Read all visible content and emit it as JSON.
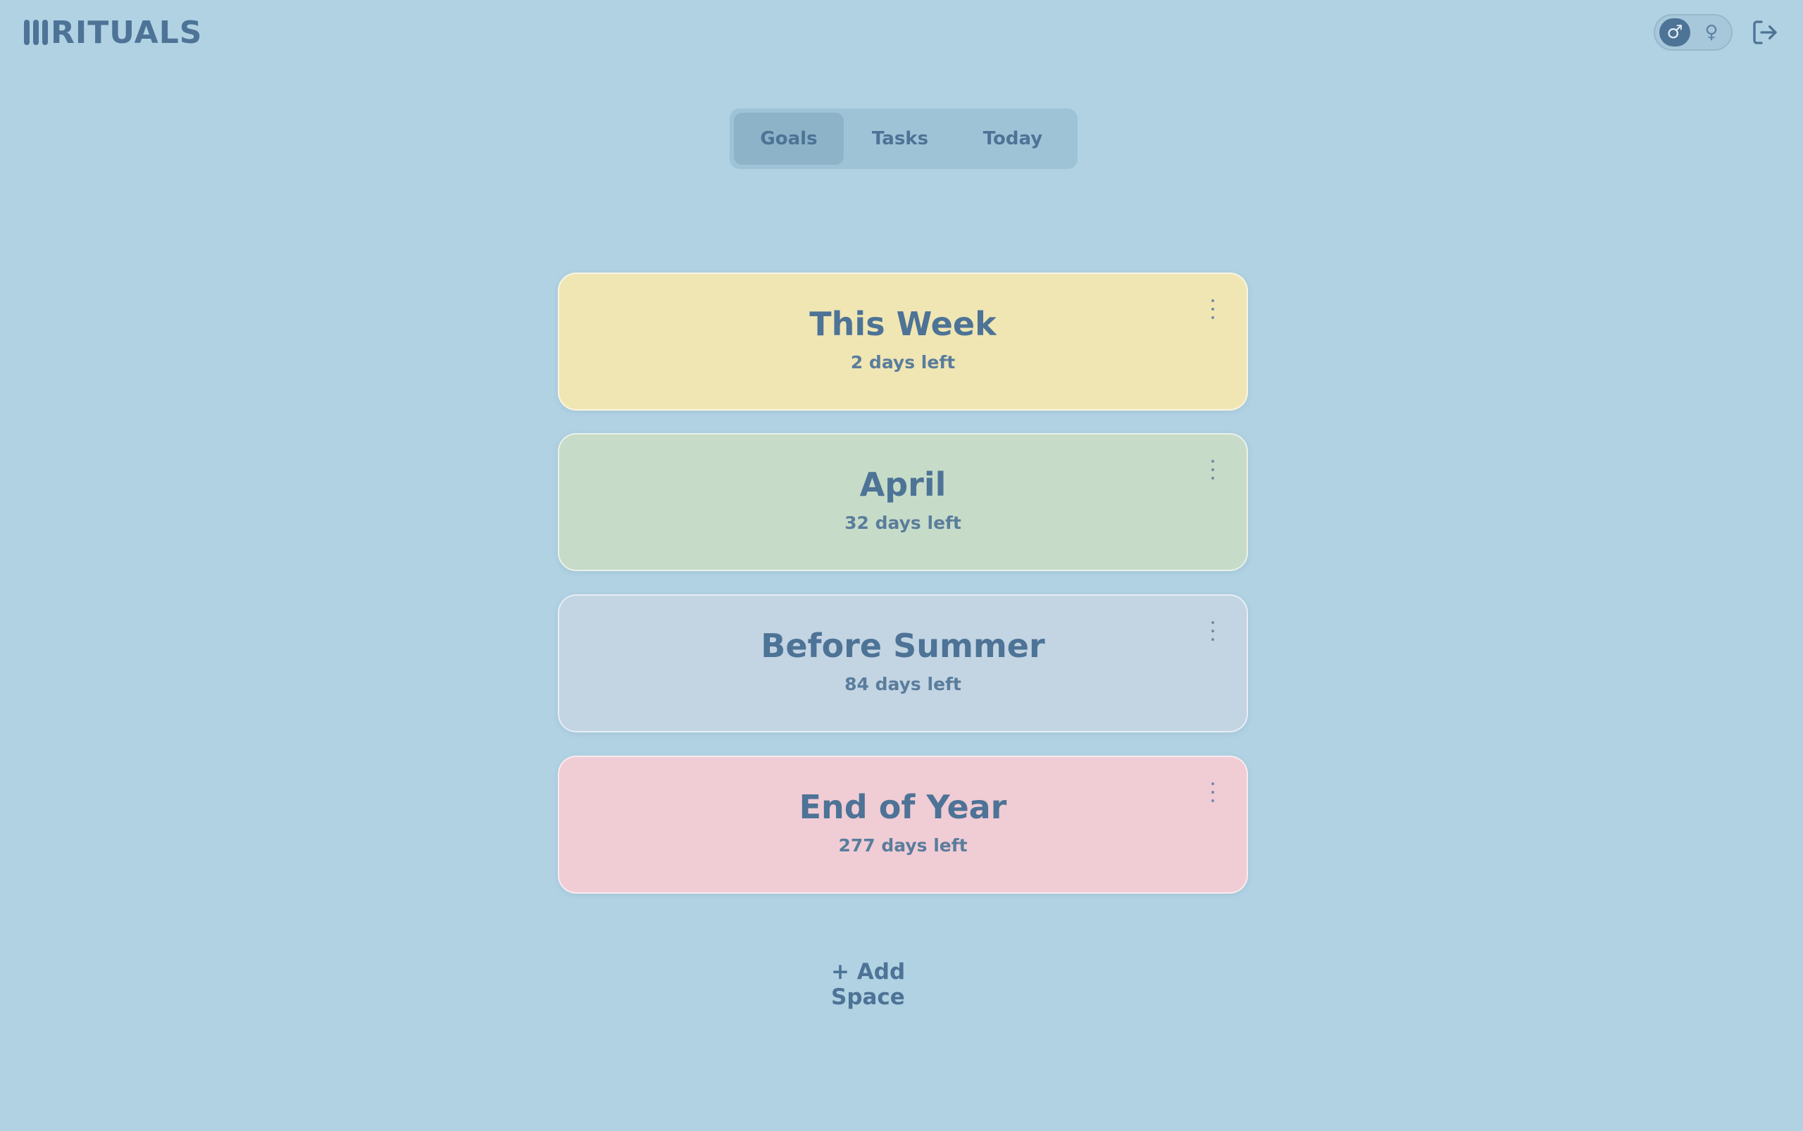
{
  "app": {
    "title": "RITUALS"
  },
  "header": {
    "toggle": {
      "male_symbol": "♂",
      "female_symbol": "♀",
      "selected": "male"
    },
    "logout_icon": "logout-icon"
  },
  "tabs": [
    {
      "label": "Goals",
      "active": true
    },
    {
      "label": "Tasks",
      "active": false
    },
    {
      "label": "Today",
      "active": false
    }
  ],
  "spaces": [
    {
      "title": "This Week",
      "subtitle": "2 days left",
      "color": "#f0e6b4"
    },
    {
      "title": "April",
      "subtitle": "32 days left",
      "color": "#c7dcc8"
    },
    {
      "title": "Before Summer",
      "subtitle": "84 days left",
      "color": "#c3d4e3"
    },
    {
      "title": "End of Year",
      "subtitle": "277 days left",
      "color": "#f0ccd5"
    }
  ],
  "add_space_label": "+ Add Space",
  "colors": {
    "background": "#b1d2e3",
    "text": "#4d7396",
    "tab_active": "#8db3c8"
  }
}
